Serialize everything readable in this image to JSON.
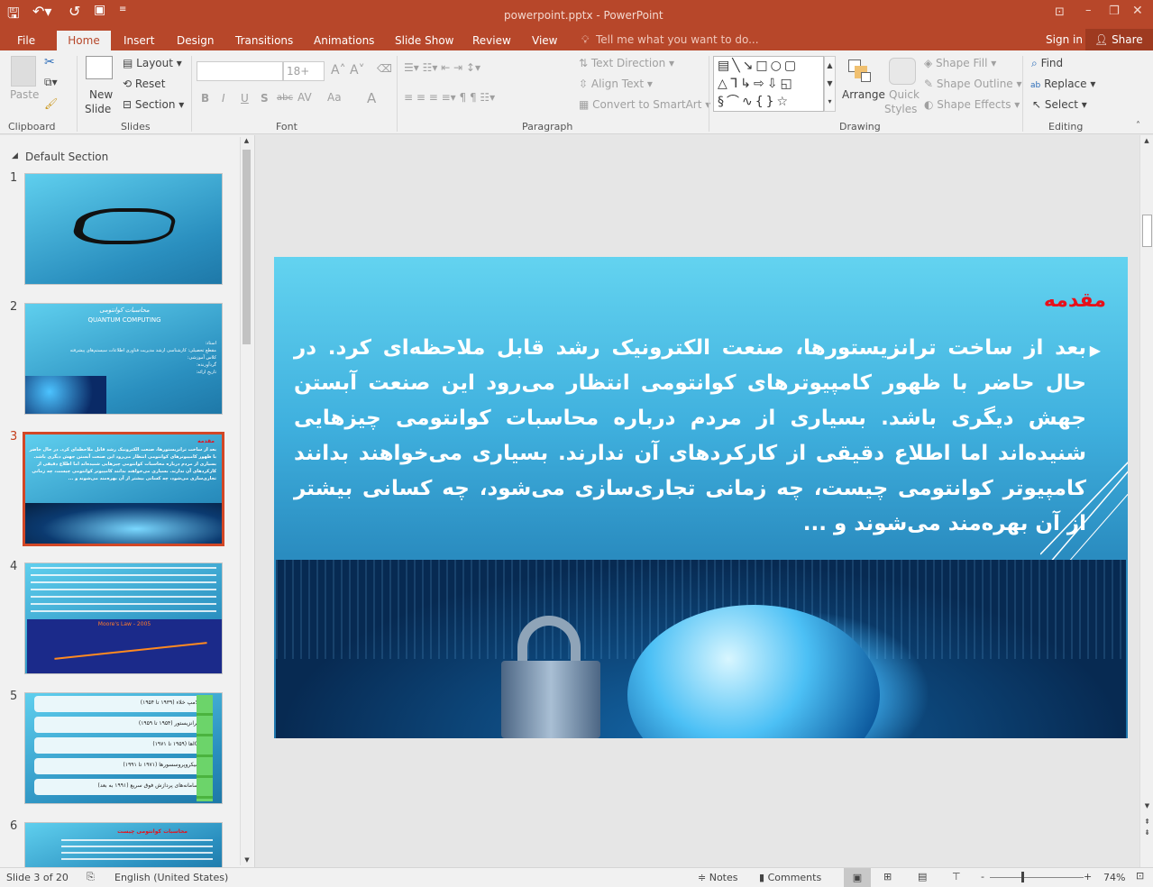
{
  "window": {
    "title": "powerpoint.pptx - PowerPoint"
  },
  "tabs": [
    "File",
    "Home",
    "Insert",
    "Design",
    "Transitions",
    "Animations",
    "Slide Show",
    "Review",
    "View"
  ],
  "active_tab": "Home",
  "tell_me": "Tell me what you want to do...",
  "sign_in": "Sign in",
  "share": "Share",
  "ribbon": {
    "clipboard": {
      "paste": "Paste",
      "label": "Clipboard"
    },
    "slides": {
      "new_slide_1": "New",
      "new_slide_2": "Slide",
      "layout": "Layout",
      "reset": "Reset",
      "section": "Section",
      "label": "Slides"
    },
    "font": {
      "font_name": "",
      "font_size": "18+",
      "bold": "B",
      "italic": "I",
      "underline": "U",
      "shadow": "S",
      "strike": "abc",
      "spacing": "AV",
      "case": "Aa",
      "color": "A",
      "label": "Font"
    },
    "paragraph": {
      "text_direction": "Text Direction",
      "align_text": "Align Text",
      "convert_smartart": "Convert to SmartArt",
      "label": "Paragraph"
    },
    "drawing": {
      "arrange": "Arrange",
      "quick_styles_1": "Quick",
      "quick_styles_2": "Styles",
      "shape_fill": "Shape Fill",
      "shape_outline": "Shape Outline",
      "shape_effects": "Shape Effects",
      "label": "Drawing"
    },
    "editing": {
      "find": "Find",
      "replace": "Replace",
      "select": "Select",
      "label": "Editing"
    }
  },
  "pane": {
    "section": "Default Section",
    "slides": [
      {
        "num": "1"
      },
      {
        "num": "2",
        "title": "محاسبات کوانتومی",
        "subtitle": "QUANTUM COMPUTING",
        "bullets": [
          "استاد:",
          "مقطع تحصیلی: کارشناسی ارشد مدیریت فناوری اطلاعات سیستم‌های پیشرفته",
          "کلاس آموزشی:",
          "گردآورنده:",
          "تاریخ ارائه:"
        ]
      },
      {
        "num": "3",
        "title": "مقدمه"
      },
      {
        "num": "4",
        "chart_title": "Moore's Law - 2005"
      },
      {
        "num": "5",
        "items": [
          "لامپ خلاء (۱۹۳۹ تا ۱۹۵۴)",
          "ترانزیستور (۱۹۵۴ تا ۱۹۵۹)",
          "ICها (۱۹۵۹ تا ۱۹۷۱)",
          "میکروپروسسورها (۱۹۷۱ تا ۱۹۹۱)",
          "سامانه‌های پردازش فوق سریع (۱۹۹۱ به بعد)"
        ]
      },
      {
        "num": "6",
        "title": "محاسبات کوانتومی چیست"
      }
    ]
  },
  "slide": {
    "title": "مقدمه",
    "body": "بعد از ساخت ترانزیستورها، صنعت الکترونیک رشد قابل ملاحظه‌ای کرد. در حال حاضر با ظهور کامپیوترهای کوانتومی انتظار می‌رود این صنعت آبستن جهش دیگری باشد. بسیاری از مردم درباره محاسبات کوانتومی چیزهایی شنیده‌اند اما اطلاع دقیقی از کارکردهای آن ندارند. بسیاری می‌خواهند بدانند کامپیوتر کوانتومی چیست، چه زمانی تجاری‌سازی می‌شود، چه کسانی بیشتر از آن بهره‌مند می‌شوند و ...",
    "title_color": "#e8101a"
  },
  "status": {
    "slide_info": "Slide 3 of 20",
    "language": "English (United States)",
    "notes": "Notes",
    "comments": "Comments",
    "zoom": "74%",
    "zoom_value": 74
  },
  "colors": {
    "accent": "#b7472a"
  }
}
